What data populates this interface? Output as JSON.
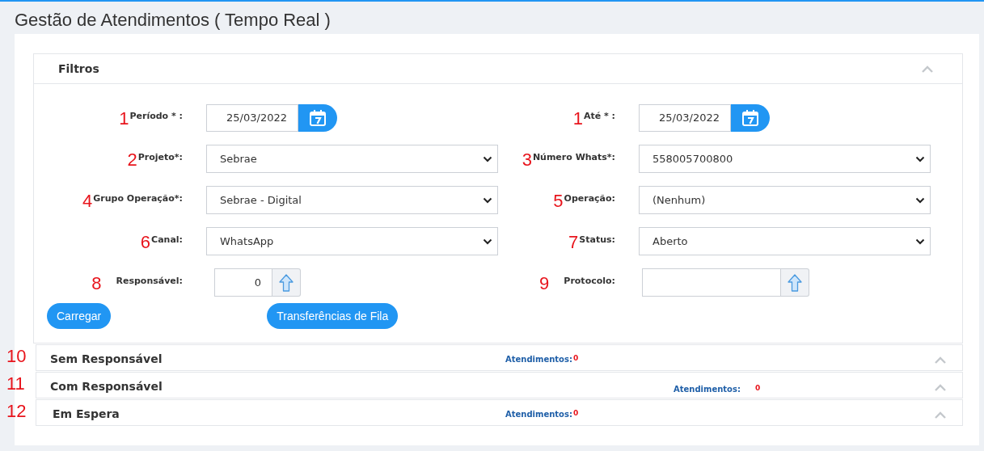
{
  "title": "Gestão de Atendimentos ( Tempo Real )",
  "filters": {
    "title": "Filtros",
    "fields": [
      {
        "marker": "1",
        "label": "Período * :",
        "kind": "date",
        "value": "25/03/2022"
      },
      {
        "marker": "1",
        "label": "Até * :",
        "kind": "date",
        "value": "25/03/2022"
      },
      {
        "marker": "2",
        "label": "Projeto*:",
        "kind": "select",
        "value": "Sebrae"
      },
      {
        "marker": "3",
        "label": "Número Whats*:",
        "kind": "select",
        "value": "558005700800"
      },
      {
        "marker": "4",
        "label": "Grupo Operação*:",
        "kind": "select",
        "value": "Sebrae - Digital"
      },
      {
        "marker": "5",
        "label": "Operação:",
        "kind": "select",
        "value": "(Nenhum)"
      },
      {
        "marker": "6",
        "label": "Canal:",
        "kind": "select",
        "value": "WhatsApp"
      },
      {
        "marker": "7",
        "label": "Status:",
        "kind": "select",
        "value": "Aberto"
      },
      {
        "marker": "8",
        "label": "Responsável:",
        "kind": "lookup",
        "value": "0"
      },
      {
        "marker": "9",
        "label": "Protocolo:",
        "kind": "lookup"
      }
    ],
    "buttons": [
      "Carregar",
      "Transferências de Fila"
    ]
  },
  "sections": [
    {
      "marker": "10",
      "title": "Sem Responsável",
      "count_label": "Atendimentos:",
      "count": "0"
    },
    {
      "marker": "11",
      "title": "Com Responsável",
      "count_label": "Atendimentos:",
      "count": "0"
    },
    {
      "marker": "12",
      "title": "Em Espera",
      "count_label": "Atendimentos:",
      "count": "0"
    }
  ]
}
